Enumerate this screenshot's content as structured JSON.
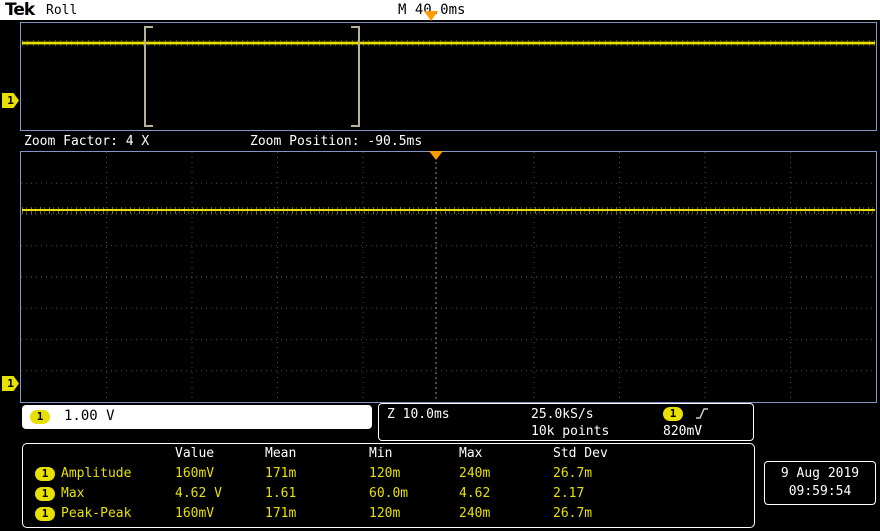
{
  "header": {
    "logo": "Tek",
    "mode": "Roll",
    "timebase": "M 40.0ms"
  },
  "overview": {
    "channel_badge": "1"
  },
  "zoombar": {
    "factor": "Zoom Factor: 4 X",
    "position": "Zoom Position: -90.5ms"
  },
  "main": {
    "channel_badge": "1"
  },
  "channel_readout": {
    "badge": "1",
    "scale": "1.00 V"
  },
  "acquisition": {
    "zoom_timebase": "Z 10.0ms",
    "sample_rate": "25.0kS/s",
    "record_length": "10k points",
    "trigger_badge": "1",
    "trigger_level": "820mV"
  },
  "measurements": {
    "columns": [
      "Value",
      "Mean",
      "Min",
      "Max",
      "Std Dev"
    ],
    "rows": [
      {
        "badge": "1",
        "label": "Amplitude",
        "value": "160mV",
        "mean": "171m",
        "min": "120m",
        "max": "240m",
        "std": "26.7m"
      },
      {
        "badge": "1",
        "label": "Max",
        "value": "4.62 V",
        "mean": "1.61",
        "min": "60.0m",
        "max": "4.62",
        "std": "2.17"
      },
      {
        "badge": "1",
        "label": "Peak-Peak",
        "value": "160mV",
        "mean": "171m",
        "min": "120m",
        "max": "240m",
        "std": "26.7m"
      }
    ]
  },
  "clock": {
    "date": "9 Aug 2019",
    "time": "09:59:54"
  },
  "colors": {
    "trace": "#e8e000",
    "trigger_marker": "#ff9c00",
    "window_border": "#8494c4"
  }
}
